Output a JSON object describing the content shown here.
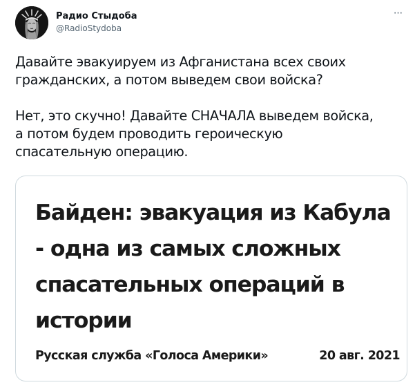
{
  "author": {
    "display_name": "Радио Стыдоба",
    "handle": "@RadioStydoba",
    "avatar_icon": "statue-of-liberty-avatar"
  },
  "more_icon": "more-options-icon",
  "more_label": "···",
  "tweet": {
    "text": "Давайте эвакуируем из Афганистана всех своих\nгражданских, а потом выведем свои войска?\n\nНет, это скучно! Давайте СНАЧАЛА выведем войска,\nа потом будем проводить героическую\nспасательную операцию."
  },
  "card": {
    "headline": "Байден: эвакуация из Кабула - одна из самых сложных спасательных операций в истории",
    "source": "Русская служба «Голоса Америки»",
    "date": "20 авг. 2021"
  },
  "colors": {
    "text": "#0f1419",
    "secondary": "#536471",
    "border": "#cfd9de",
    "headline": "#1a1a1a"
  }
}
